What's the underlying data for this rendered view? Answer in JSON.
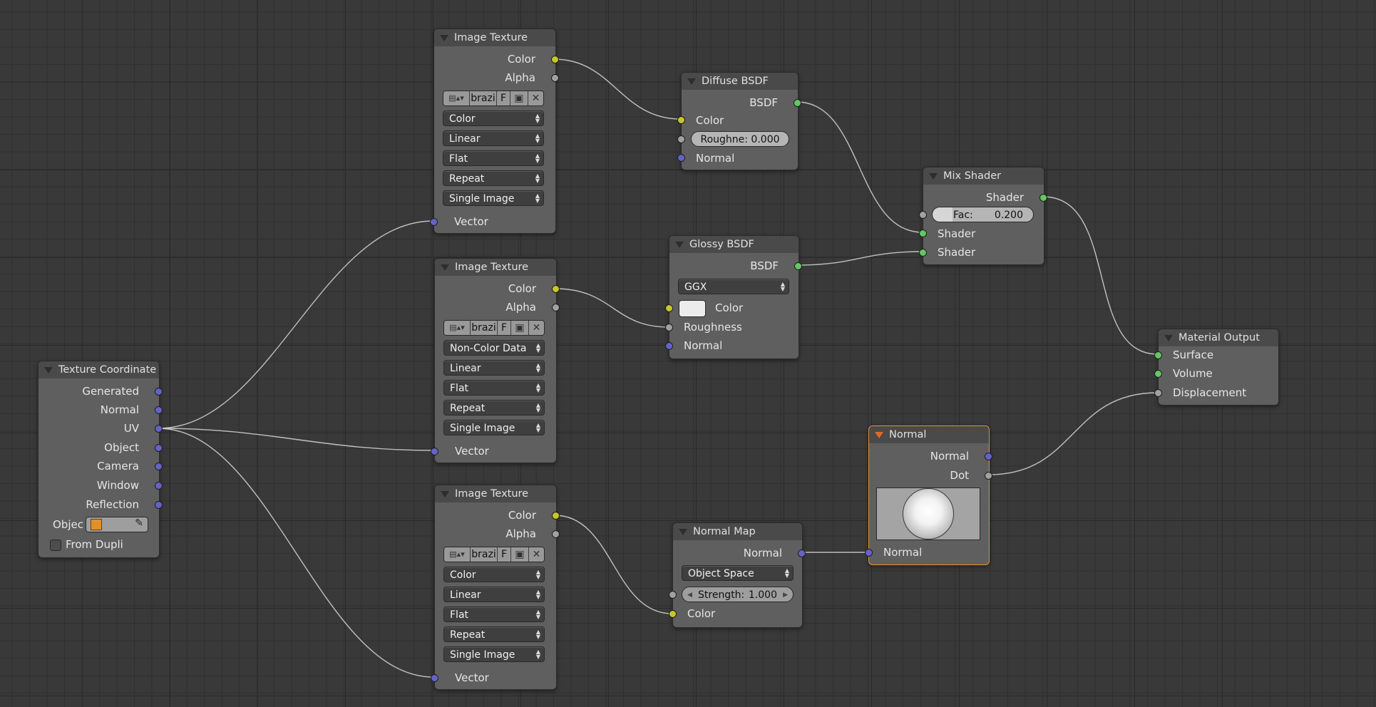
{
  "colors": {
    "socket_color": "#c7c729",
    "socket_float": "#a1a1a1",
    "socket_vector": "#6363c7",
    "socket_shader": "#63c763",
    "active_border": "#e6922c"
  },
  "icons": {
    "image_browse": "image-browse-icon",
    "fake_user": "fake-user-icon",
    "open_file": "folder-open-icon",
    "unlink": "close-icon",
    "object": "cube-icon",
    "eyedropper": "eyedropper-icon",
    "collapse": "triangle-down-icon"
  },
  "nodes": {
    "tex1": {
      "title": "Image Texture",
      "out_color": "Color",
      "out_alpha": "Alpha",
      "image_name": "brazi",
      "fake": "F",
      "color_space": "Color",
      "interpolation": "Linear",
      "projection": "Flat",
      "extension": "Repeat",
      "source": "Single Image",
      "in_vector": "Vector"
    },
    "tex2": {
      "title": "Image Texture",
      "out_color": "Color",
      "out_alpha": "Alpha",
      "image_name": "brazi",
      "fake": "F",
      "color_space": "Non-Color Data",
      "interpolation": "Linear",
      "projection": "Flat",
      "extension": "Repeat",
      "source": "Single Image",
      "in_vector": "Vector"
    },
    "tex3": {
      "title": "Image Texture",
      "out_color": "Color",
      "out_alpha": "Alpha",
      "image_name": "brazi",
      "fake": "F",
      "color_space": "Color",
      "interpolation": "Linear",
      "projection": "Flat",
      "extension": "Repeat",
      "source": "Single Image",
      "in_vector": "Vector"
    },
    "texcoord": {
      "title": "Texture Coordinate",
      "outputs": [
        "Generated",
        "Normal",
        "UV",
        "Object",
        "Camera",
        "Window",
        "Reflection"
      ],
      "object_label": "Objec",
      "from_dupli": "From Dupli"
    },
    "diffuse": {
      "title": "Diffuse BSDF",
      "out_bsdf": "BSDF",
      "in_color": "Color",
      "roughness": "Roughne: 0.000",
      "in_normal": "Normal"
    },
    "glossy": {
      "title": "Glossy BSDF",
      "out_bsdf": "BSDF",
      "distribution": "GGX",
      "in_color": "Color",
      "in_roughness": "Roughness",
      "in_normal": "Normal"
    },
    "mix": {
      "title": "Mix Shader",
      "out_shader": "Shader",
      "fac_label": "Fac:",
      "fac_value": "0.200",
      "in_shader1": "Shader",
      "in_shader2": "Shader"
    },
    "output": {
      "title": "Material Output",
      "in_surface": "Surface",
      "in_volume": "Volume",
      "in_displacement": "Displacement"
    },
    "normal": {
      "title": "Normal",
      "out_normal": "Normal",
      "out_dot": "Dot",
      "in_normal": "Normal"
    },
    "normalmap": {
      "title": "Normal Map",
      "out_normal": "Normal",
      "space": "Object Space",
      "strength_label": "Strength:",
      "strength_value": "1.000",
      "in_color": "Color"
    }
  }
}
